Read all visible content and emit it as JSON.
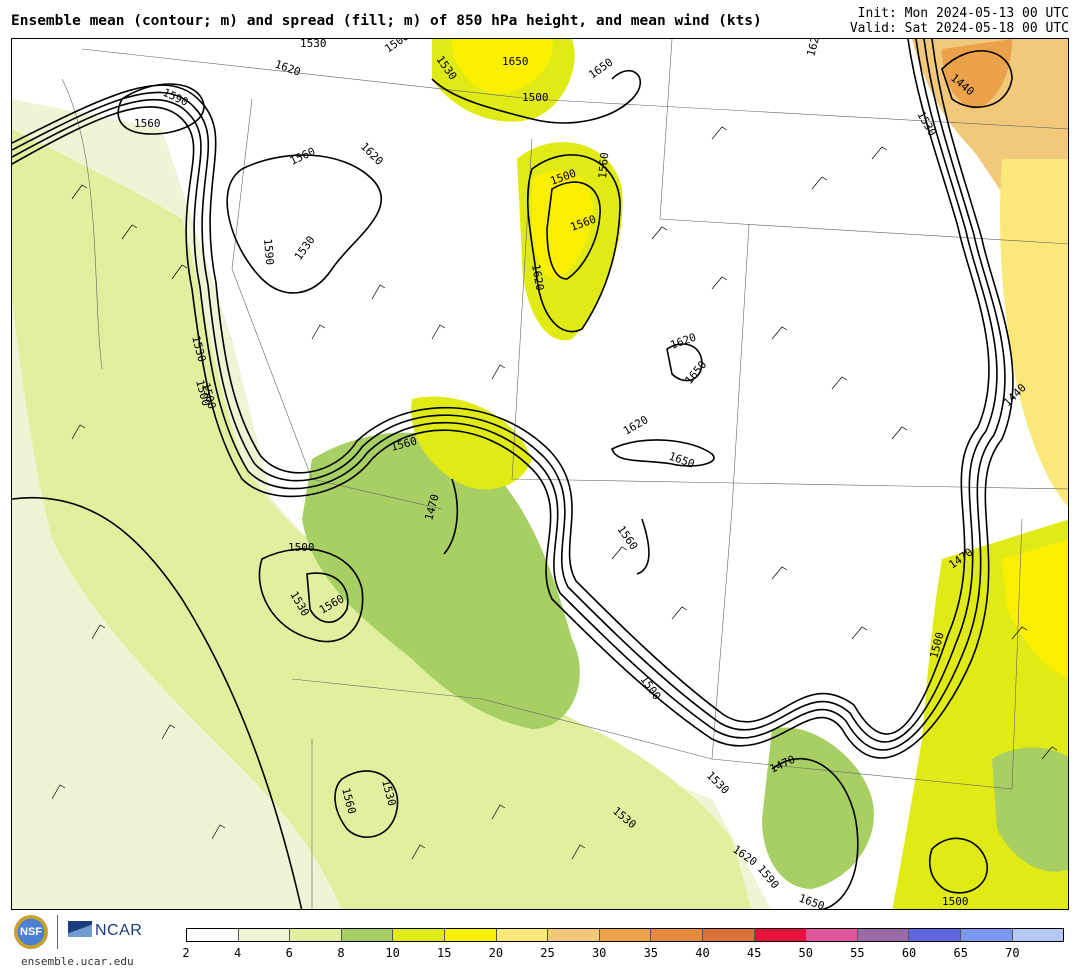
{
  "header": {
    "title": "Ensemble mean (contour; m) and spread (fill; m) of 850 hPa height, and mean wind (kts)",
    "init": "Init: Mon 2024-05-13 00 UTC",
    "valid": "Valid: Sat 2024-05-18 00 UTC"
  },
  "footer": {
    "nsf_text": "NSF",
    "ncar_text": "NCAR",
    "url": "ensemble.ucar.edu"
  },
  "colorbar": {
    "ticks": [
      "2",
      "4",
      "6",
      "8",
      "10",
      "15",
      "20",
      "25",
      "30",
      "35",
      "40",
      "45",
      "50",
      "55",
      "60",
      "65",
      "70"
    ],
    "colors": [
      "#ffffff",
      "#eef5d5",
      "#e0f09e",
      "#a8cf63",
      "#e0ea14",
      "#fbef00",
      "#fbe87a",
      "#f2c97a",
      "#eba24a",
      "#e38a3e",
      "#d9733a",
      "#e8123c",
      "#e0569a",
      "#9a6aa8",
      "#6065e0",
      "#7b98f0",
      "#b6c8f4"
    ]
  },
  "contour_labels": [
    {
      "text": "1530"
    },
    {
      "text": "1620"
    },
    {
      "text": "1500"
    },
    {
      "text": "1590"
    },
    {
      "text": "1560"
    },
    {
      "text": "1650"
    },
    {
      "text": "1530"
    },
    {
      "text": "1500"
    },
    {
      "text": "1560"
    },
    {
      "text": "1620"
    },
    {
      "text": "1500"
    },
    {
      "text": "1560"
    },
    {
      "text": "1590"
    },
    {
      "text": "1530"
    },
    {
      "text": "1560"
    },
    {
      "text": "1620"
    },
    {
      "text": "1650"
    },
    {
      "text": "1440"
    },
    {
      "text": "1530"
    },
    {
      "text": "1500"
    },
    {
      "text": "1560"
    },
    {
      "text": "1470"
    },
    {
      "text": "1620"
    },
    {
      "text": "1650"
    },
    {
      "text": "1500"
    },
    {
      "text": "1530"
    },
    {
      "text": "1560"
    },
    {
      "text": "1500"
    },
    {
      "text": "1470"
    },
    {
      "text": "1500"
    },
    {
      "text": "1500"
    },
    {
      "text": "1560"
    },
    {
      "text": "1530"
    },
    {
      "text": "1530"
    },
    {
      "text": "1530"
    },
    {
      "text": "1470"
    },
    {
      "text": "1560"
    },
    {
      "text": "1620"
    },
    {
      "text": "1590"
    },
    {
      "text": "1650"
    },
    {
      "text": "1530"
    },
    {
      "text": "1500"
    },
    {
      "text": "1440"
    },
    {
      "text": "1620"
    },
    {
      "text": "1650"
    },
    {
      "text": "1620"
    }
  ]
}
